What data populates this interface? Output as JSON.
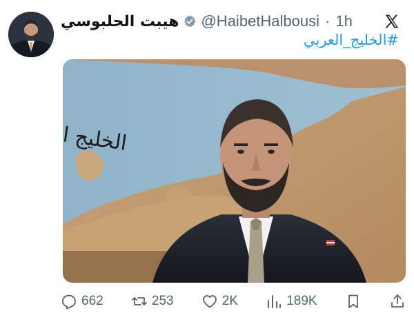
{
  "tweet": {
    "author_name": "هيبت الحلبوسي",
    "handle": "@HaibetHalbousi",
    "separator": "·",
    "time": "1h",
    "hashtag": "#الخليج_العربي",
    "image_caption": "الخليج العربي"
  },
  "actions": {
    "replies": "662",
    "reposts": "253",
    "likes": "2K",
    "views": "189K"
  },
  "colors": {
    "link": "#1d9bf0",
    "secondary_text": "#536471",
    "verified_gray": "#829aab"
  }
}
